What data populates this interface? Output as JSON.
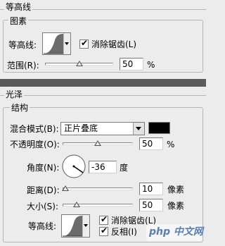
{
  "quality": {
    "title": "等高线",
    "group_elements": "图素",
    "contour_label": "等高线:",
    "antialias_label": "消除锯齿(L)",
    "antialias_checked": true,
    "range_label": "范围(R):",
    "range_value": "50",
    "range_level": 0.5,
    "range_unit": "%"
  },
  "gloss": {
    "title": "光泽",
    "group_structure": "结构",
    "blend_mode_label": "混合模式(B):",
    "blend_mode_value": "正片叠底",
    "color": "#000000",
    "opacity_label": "不透明度(O):",
    "opacity_value": "50",
    "opacity_level": 0.5,
    "opacity_unit": "%",
    "angle_label": "角度(N):",
    "angle_value": "-36",
    "angle_unit": "度",
    "distance_label": "距离(D):",
    "distance_value": "10",
    "distance_level": 0.04,
    "distance_unit": "像素",
    "size_label": "大小(S):",
    "size_value": "50",
    "size_level": 0.2,
    "size_unit": "像素",
    "contour_label": "等高线:",
    "antialias_label": "消除锯齿(L)",
    "antialias_checked": true,
    "invert_label": "反相(I)",
    "invert_checked": true
  },
  "watermark": {
    "text": "php 中文网"
  }
}
